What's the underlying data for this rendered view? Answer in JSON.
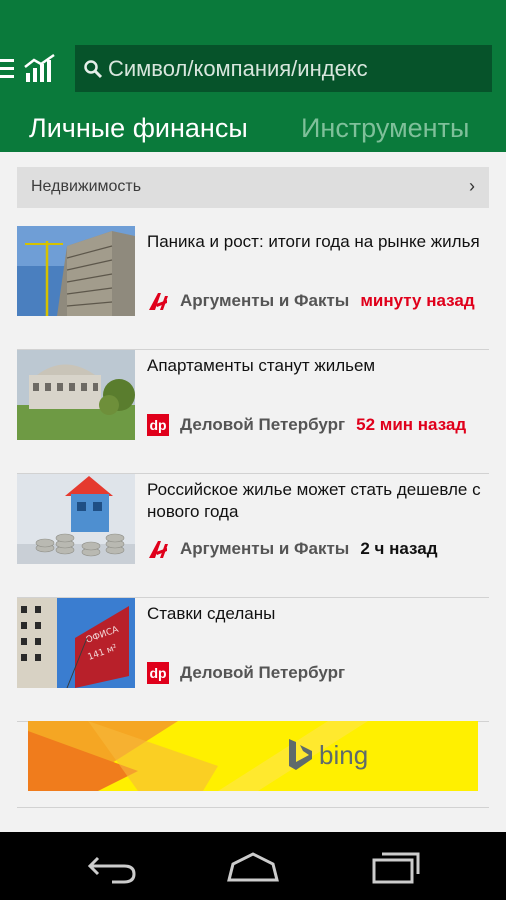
{
  "header": {
    "search_placeholder": "Символ/компания/индекс",
    "tabs": [
      {
        "label": "Личные финансы",
        "active": true
      },
      {
        "label": "Инструменты",
        "active": false
      }
    ]
  },
  "section": {
    "label": "Недвижимость",
    "chevron": "›"
  },
  "articles": [
    {
      "headline": "Паника и рост: итоги года на рынке жилья",
      "source": "Аргументы и Факты",
      "source_icon": "aif-logo",
      "time": "минуту назад",
      "time_color": "#e0001b"
    },
    {
      "headline": "Апартаменты станут жильем",
      "source": "Деловой Петербург",
      "source_icon": "dp-logo",
      "time": "52 мин назад",
      "time_color": "#e0001b"
    },
    {
      "headline": "Российское жилье может стать дешевле с нового года",
      "source": "Аргументы и Факты",
      "source_icon": "aif-logo",
      "time": "2 ч назад",
      "time_color": "#111111"
    },
    {
      "headline": "Ставки сделаны",
      "source": "Деловой Петербург",
      "source_icon": "dp-logo",
      "time": "",
      "time_color": "#111111"
    }
  ],
  "ad": {
    "brand": "bing"
  },
  "colors": {
    "header": "#0a7a3b",
    "search_bg": "#06532a",
    "accent_red": "#e0001b",
    "ad_yellow": "#fff000"
  }
}
